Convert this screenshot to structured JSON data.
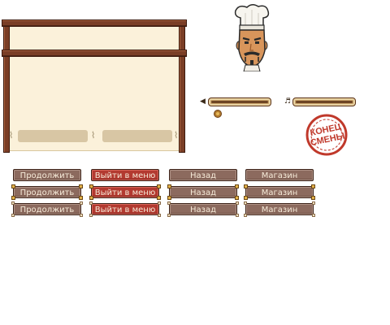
{
  "buttons": {
    "continue_label": "Продолжить",
    "exit_menu_label": "Выйти в меню",
    "back_label": "Назад",
    "shop_label": "Магазин",
    "rows": [
      {
        "variant": "plain"
      },
      {
        "variant": "bolted-gold"
      },
      {
        "variant": "bolted-light"
      }
    ]
  },
  "stamp": {
    "line1": "КОНЕЦ",
    "line2": "СМЕНЫ",
    "color": "#c0392b"
  },
  "sliders": {
    "sound": {
      "icon": "speaker-icon",
      "glyph": "◀",
      "level": 1.0
    },
    "music": {
      "icon": "music-note-icon",
      "glyph": "♬",
      "level": 1.0
    }
  },
  "colors": {
    "wood": "#7a3e26",
    "parchment": "#fbf1da",
    "button_brown": "#8c6a5e",
    "button_red": "#b33a30",
    "bolt_gold": "#e3b24a"
  },
  "icons": {
    "chef": "chef-portrait-icon",
    "knob": "round-knob-icon"
  }
}
